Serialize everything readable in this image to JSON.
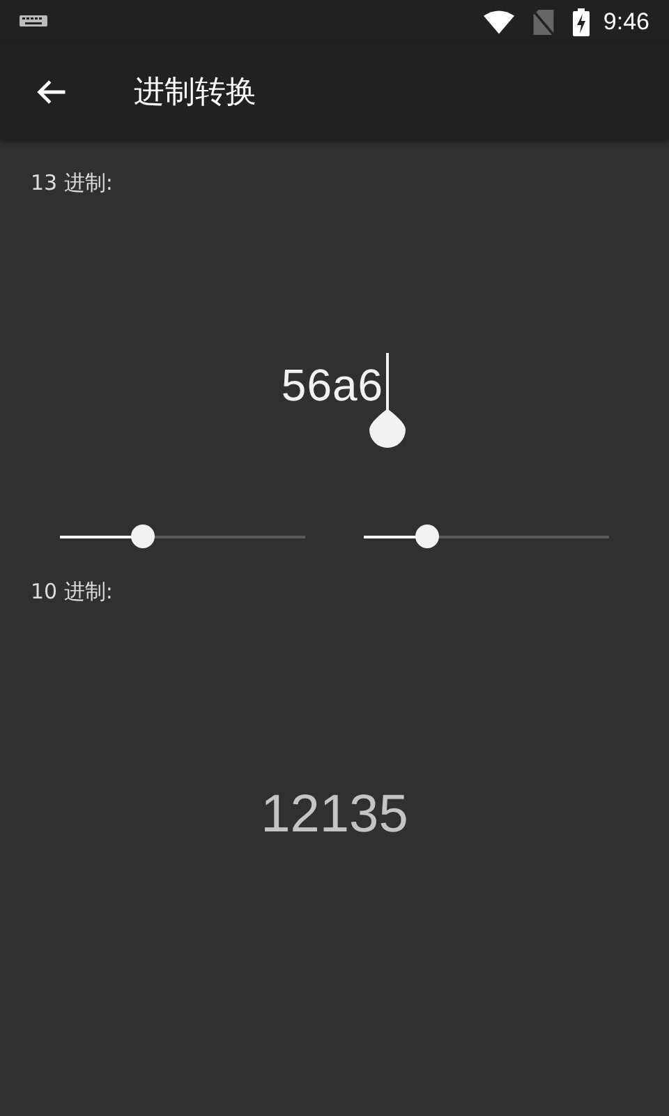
{
  "status_bar": {
    "time": "9:46"
  },
  "app_bar": {
    "title": "进制转换"
  },
  "input": {
    "label": "13 进制:",
    "value": "56a6"
  },
  "sliders": [
    {
      "level": 0.32
    },
    {
      "level": 0.23
    }
  ],
  "output": {
    "label": "10 进制:",
    "value": "12135"
  }
}
